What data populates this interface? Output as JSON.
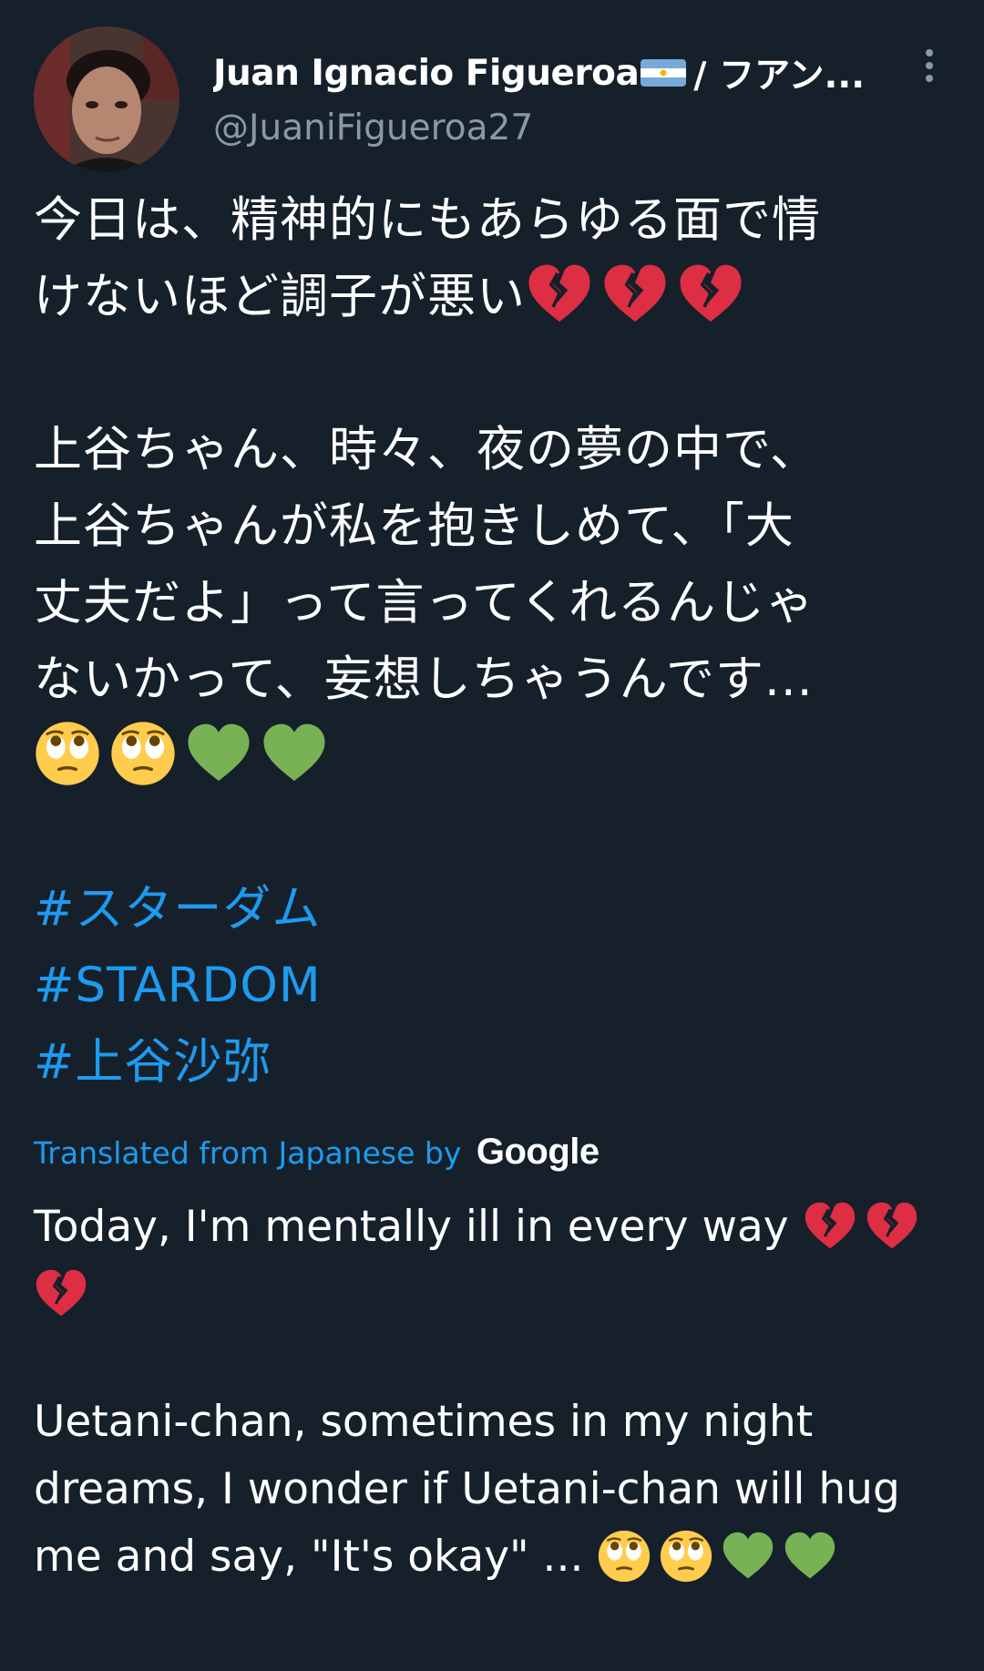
{
  "tweet": {
    "author": {
      "display_name": "Juan Ignacio Figueroa",
      "name_suffix": "/ フアン...",
      "handle": "@JuaniFigueroa27",
      "flag": "argentina-flag-icon"
    },
    "text": {
      "line1": "今日は、精神的にもあらゆる面で情",
      "line2": "けないほど調子が悪い",
      "line2_emojis": [
        "broken-heart-icon",
        "broken-heart-icon",
        "broken-heart-icon"
      ],
      "line3": "上谷ちゃん、時々、夜の夢の中で、",
      "line4": "上谷ちゃんが私を抱きしめて、「大",
      "line5": "丈夫だよ」って言ってくれるんじゃ",
      "line6": "ないかって、妄想しちゃうんです...",
      "line7_emojis": [
        "face-with-rolling-eyes-icon",
        "face-with-rolling-eyes-icon",
        "green-heart-icon",
        "green-heart-icon"
      ]
    },
    "hashtags": [
      "#スターダム",
      "#STARDOM",
      "#上谷沙弥"
    ],
    "translation": {
      "label": "Translated from Japanese by",
      "provider": "Google",
      "line1": "Today, I'm mentally ill in every way",
      "line3": " Uetani-chan, sometimes in my night",
      "line4": "dreams, I wonder if Uetani-chan will hug",
      "line5": "me and say, \"It's okay\" ..."
    }
  },
  "colors": {
    "background": "#15202b",
    "text": "#ffffff",
    "secondary": "#8b98a5",
    "link": "#1d9bf0"
  }
}
